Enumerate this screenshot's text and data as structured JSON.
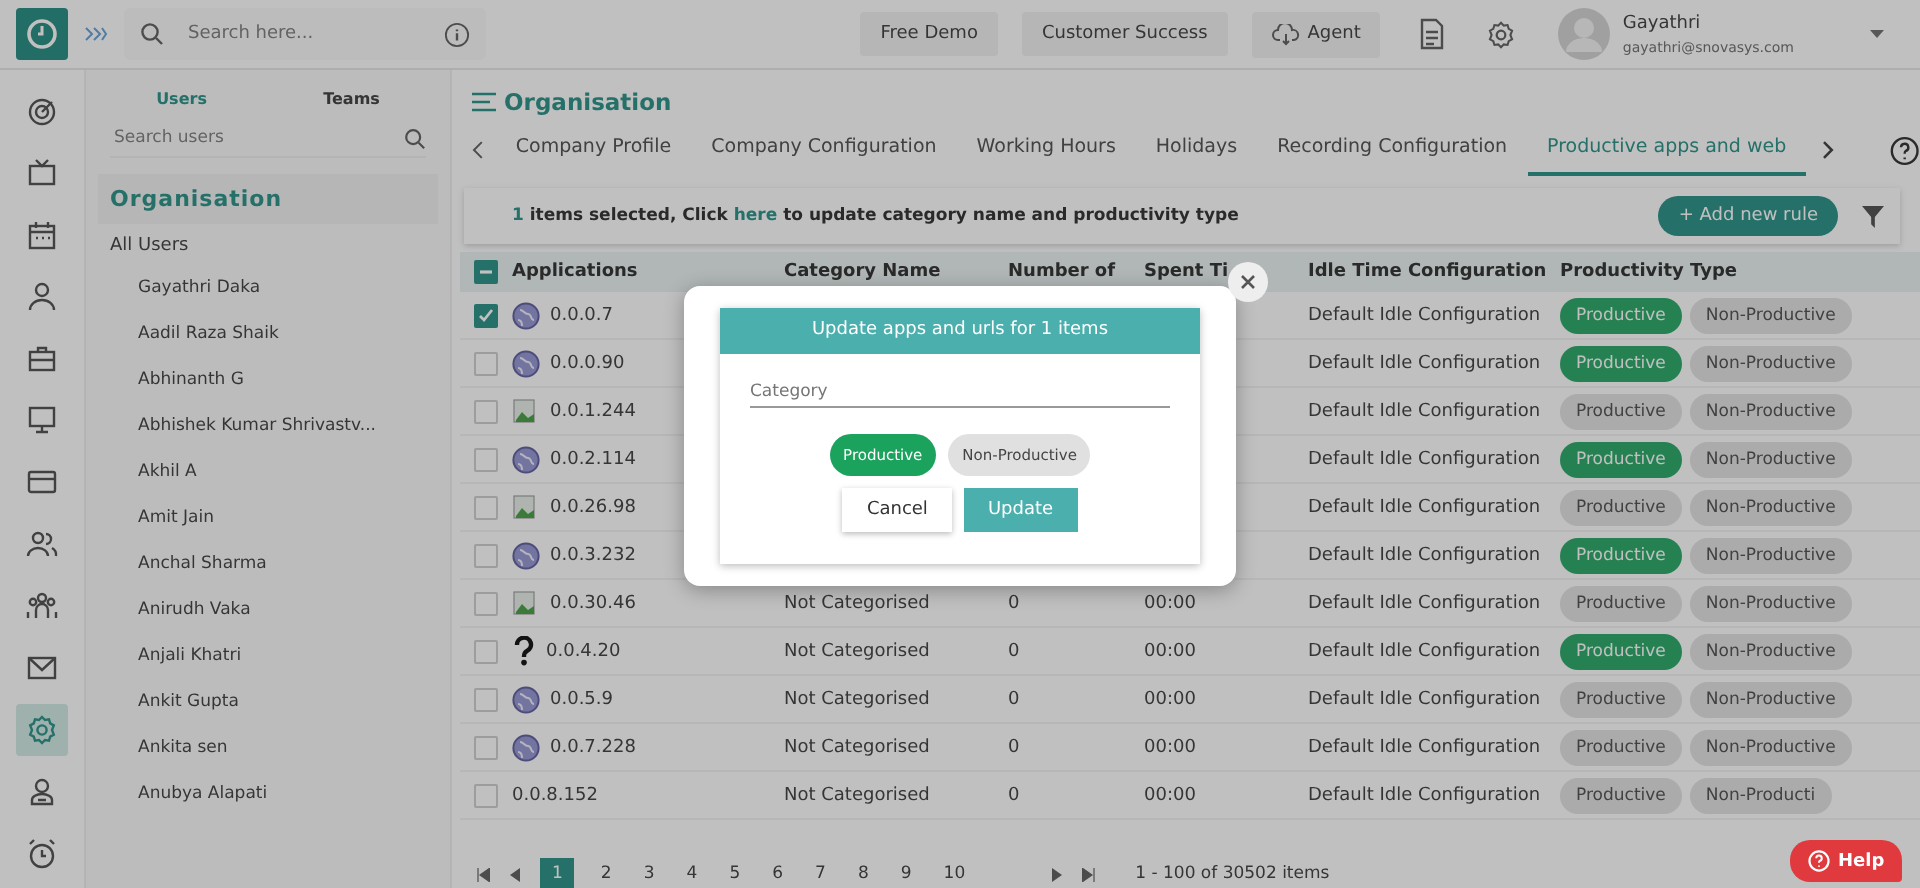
{
  "header": {
    "search": {
      "placeholder": "Search here..."
    },
    "buttons": [
      {
        "label": "Free Demo",
        "kind": "plain"
      },
      {
        "label": "Customer Success",
        "kind": "plain"
      },
      {
        "label": "Agent",
        "kind": "cloud"
      }
    ],
    "user": {
      "name": "Gayathri",
      "email": "gayathri@snovasys.com"
    }
  },
  "rail": [
    {
      "kind": "target",
      "selected": false
    },
    {
      "kind": "tv",
      "selected": false
    },
    {
      "kind": "calendar",
      "selected": false
    },
    {
      "kind": "user",
      "selected": false
    },
    {
      "kind": "briefcase",
      "selected": false
    },
    {
      "kind": "monitor",
      "selected": false
    },
    {
      "kind": "card",
      "selected": false
    },
    {
      "kind": "users",
      "selected": false
    },
    {
      "kind": "team",
      "selected": false
    },
    {
      "kind": "mail",
      "selected": false
    },
    {
      "kind": "gear",
      "selected": true
    },
    {
      "kind": "badge",
      "selected": false
    },
    {
      "kind": "alarm",
      "selected": false
    }
  ],
  "users_panel": {
    "tabs": [
      {
        "label": "Users",
        "selected": true
      },
      {
        "label": "Teams",
        "selected": false
      }
    ],
    "search": {
      "placeholder": "Search users"
    },
    "heading": "Organisation",
    "all_users": "All Users",
    "users": [
      "Gayathri Daka",
      "Aadil Raza Shaik",
      "Abhinanth G",
      "Abhishek Kumar Shrivastv...",
      "Akhil A",
      "Amit Jain",
      "Anchal Sharma",
      "Anirudh Vaka",
      "Anjali Khatri",
      "Ankit Gupta",
      "Ankita sen",
      "Anubya Alapati"
    ]
  },
  "page_title": "Organisation",
  "tabs": [
    {
      "label": "Company Profile",
      "selected": false
    },
    {
      "label": "Company Configuration",
      "selected": false
    },
    {
      "label": "Working Hours",
      "selected": false
    },
    {
      "label": "Holidays",
      "selected": false
    },
    {
      "label": "Recording Configuration",
      "selected": false
    },
    {
      "label": "Productive apps and web",
      "selected": true
    }
  ],
  "selection_bar": {
    "count": "1",
    "before": "items selected, Click",
    "link": "here",
    "after": "to update category name and productivity type",
    "add_button": "+ Add new rule"
  },
  "table": {
    "select_all_partial": true,
    "columns": [
      "Applications",
      "Category Name",
      "Number of",
      "Spent Ti",
      "Idle Time Configuration",
      "Productivity Type"
    ],
    "rows": [
      {
        "checked": true,
        "kind": "globe",
        "app": "0.0.0.7",
        "idle": "Default Idle Configuration",
        "types": [
          {
            "label": "Productive",
            "selected": true
          },
          {
            "label": "Non-Productive",
            "selected": false
          }
        ]
      },
      {
        "checked": false,
        "kind": "globe",
        "app": "0.0.0.90",
        "idle": "Default Idle Configuration",
        "types": [
          {
            "label": "Productive",
            "selected": true
          },
          {
            "label": "Non-Productive",
            "selected": false
          }
        ]
      },
      {
        "checked": false,
        "kind": "broken",
        "app": "0.0.1.244",
        "idle": "Default Idle Configuration",
        "types": [
          {
            "label": "Productive",
            "selected": false
          },
          {
            "label": "Non-Productive",
            "selected": false
          }
        ]
      },
      {
        "checked": false,
        "kind": "globe",
        "app": "0.0.2.114",
        "idle": "Default Idle Configuration",
        "types": [
          {
            "label": "Productive",
            "selected": true
          },
          {
            "label": "Non-Productive",
            "selected": false
          }
        ]
      },
      {
        "checked": false,
        "kind": "broken",
        "app": "0.0.26.98",
        "idle": "Default Idle Configuration",
        "types": [
          {
            "label": "Productive",
            "selected": false
          },
          {
            "label": "Non-Productive",
            "selected": false
          }
        ]
      },
      {
        "checked": false,
        "kind": "globe",
        "app": "0.0.3.232",
        "idle": "Default Idle Configuration",
        "types": [
          {
            "label": "Productive",
            "selected": true
          },
          {
            "label": "Non-Productive",
            "selected": false
          }
        ]
      },
      {
        "checked": false,
        "kind": "broken",
        "app": "0.0.30.46",
        "category": "Not Categorised",
        "count": "0",
        "spent": "00:00",
        "idle": "Default Idle Configuration",
        "types": [
          {
            "label": "Productive",
            "selected": false
          },
          {
            "label": "Non-Productive",
            "selected": false
          }
        ]
      },
      {
        "checked": false,
        "kind": "question",
        "app": "0.0.4.20",
        "category": "Not Categorised",
        "count": "0",
        "spent": "00:00",
        "idle": "Default Idle Configuration",
        "types": [
          {
            "label": "Productive",
            "selected": true
          },
          {
            "label": "Non-Productive",
            "selected": false
          }
        ]
      },
      {
        "checked": false,
        "kind": "globe",
        "app": "0.0.5.9",
        "category": "Not Categorised",
        "count": "0",
        "spent": "00:00",
        "idle": "Default Idle Configuration",
        "types": [
          {
            "label": "Productive",
            "selected": false
          },
          {
            "label": "Non-Productive",
            "selected": false
          }
        ]
      },
      {
        "checked": false,
        "kind": "globe",
        "app": "0.0.7.228",
        "category": "Not Categorised",
        "count": "0",
        "spent": "00:00",
        "idle": "Default Idle Configuration",
        "types": [
          {
            "label": "Productive",
            "selected": false
          },
          {
            "label": "Non-Productive",
            "selected": false
          }
        ]
      },
      {
        "checked": false,
        "kind": "none",
        "app": "0.0.8.152",
        "category": "Not Categorised",
        "count": "0",
        "spent": "00:00",
        "idle": "Default Idle Configuration",
        "types": [
          {
            "label": "Productive",
            "selected": false
          },
          {
            "label": "Non-Producti",
            "selected": false
          }
        ]
      }
    ]
  },
  "pagination": {
    "pages": [
      {
        "label": "1",
        "selected": true
      },
      {
        "label": "2",
        "selected": false
      },
      {
        "label": "3",
        "selected": false
      },
      {
        "label": "4",
        "selected": false
      },
      {
        "label": "5",
        "selected": false
      },
      {
        "label": "6",
        "selected": false
      },
      {
        "label": "7",
        "selected": false
      },
      {
        "label": "8",
        "selected": false
      },
      {
        "label": "9",
        "selected": false
      },
      {
        "label": "10",
        "selected": false
      }
    ],
    "summary": "1 - 100 of 30502 items"
  },
  "help_button": "Help",
  "dialog": {
    "title": "Update apps and urls for 1 items",
    "category": {
      "placeholder": "Category"
    },
    "types": [
      {
        "label": "Productive",
        "selected": true
      },
      {
        "label": "Non-Productive",
        "selected": false
      }
    ],
    "buttons": [
      {
        "label": "Cancel",
        "kind": "secondary"
      },
      {
        "label": "Update",
        "kind": "primary"
      }
    ]
  }
}
